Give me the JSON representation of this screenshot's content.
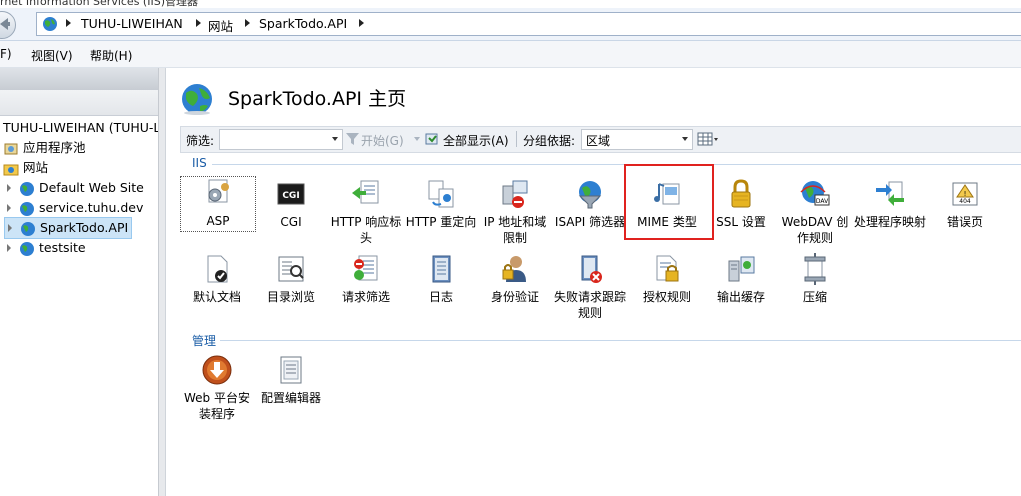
{
  "window": {
    "title_fragment": "rnet Information Services (IIS)管理器"
  },
  "address": {
    "crumbs": [
      "TUHU-LIWEIHAN",
      "网站",
      "SparkTodo.API"
    ]
  },
  "menu": {
    "file": "F)",
    "view": "视图(V)",
    "help": "帮助(H)"
  },
  "tree": {
    "server": "TUHU-LIWEIHAN (TUHU-LI",
    "app_pools": "应用程序池",
    "sites": "网站",
    "site_items": [
      "Default Web Site",
      "service.tuhu.dev",
      "SparkTodo.API",
      "testsite"
    ],
    "selected": "SparkTodo.API"
  },
  "main": {
    "title": "SparkTodo.API 主页",
    "filter_label": "筛选:",
    "start_label": "开始(G)",
    "show_all_label": "全部显示(A)",
    "group_label": "分组依据:",
    "group_value": "区域"
  },
  "sections": {
    "iis": "IIS",
    "manage": "管理"
  },
  "features_iis_row1": [
    "ASP",
    "CGI",
    "HTTP 响应标头",
    "HTTP 重定向",
    "IP 地址和域限制",
    "ISAPI 筛选器",
    "MIME 类型",
    "SSL 设置",
    "WebDAV 创作规则",
    "处理程序映射",
    "错误页"
  ],
  "features_iis_row2": [
    "默认文档",
    "目录浏览",
    "请求筛选",
    "日志",
    "身份验证",
    "失败请求跟踪规则",
    "授权规则",
    "输出缓存",
    "压缩"
  ],
  "features_manage": [
    "Web 平台安装程序",
    "配置编辑器"
  ],
  "highlighted_feature": "MIME 类型",
  "colors": {
    "selection": "#cce4f7",
    "highlight_border": "#e0221f",
    "section_text": "#1a5ca6"
  }
}
